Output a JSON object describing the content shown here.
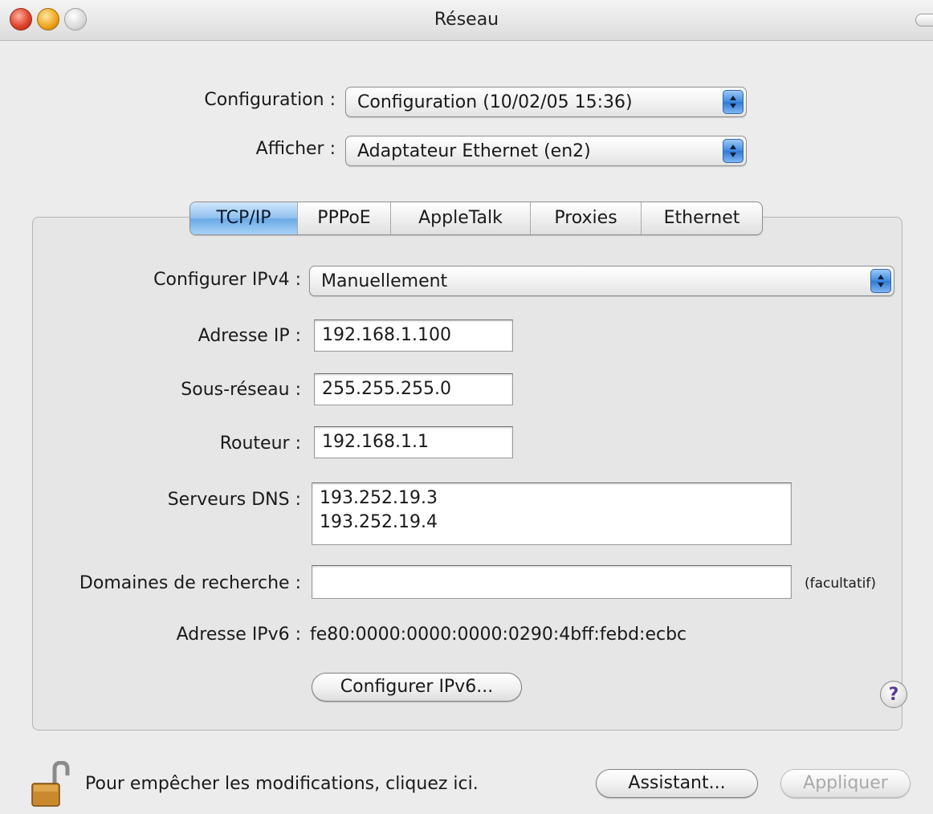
{
  "window": {
    "title": "Réseau"
  },
  "top": {
    "configuration_label": "Configuration :",
    "configuration_value": "Configuration (10/02/05 15:36)",
    "afficher_label": "Afficher :",
    "afficher_value": "Adaptateur Ethernet (en2)"
  },
  "tabs": [
    {
      "label": "TCP/IP",
      "selected": true
    },
    {
      "label": "PPPoE",
      "selected": false
    },
    {
      "label": "AppleTalk",
      "selected": false
    },
    {
      "label": "Proxies",
      "selected": false
    },
    {
      "label": "Ethernet",
      "selected": false
    }
  ],
  "tcpip": {
    "configure_ipv4_label": "Configurer IPv4 :",
    "configure_ipv4_value": "Manuellement",
    "ip_label": "Adresse IP :",
    "ip_value": "192.168.1.100",
    "subnet_label": "Sous-réseau :",
    "subnet_value": "255.255.255.0",
    "router_label": "Routeur :",
    "router_value": "192.168.1.1",
    "dns_label": "Serveurs DNS :",
    "dns_values": [
      "193.252.19.3",
      "193.252.19.4"
    ],
    "search_domains_label": "Domaines de recherche :",
    "search_domains_value": "",
    "optional_note": "(facultatif)",
    "ipv6_label": "Adresse IPv6 :",
    "ipv6_value": "fe80:0000:0000:0000:0290:4bff:febd:ecbc",
    "configure_ipv6_button": "Configurer IPv6...",
    "help_glyph": "?"
  },
  "footer": {
    "lock_text": "Pour empêcher les modifications, cliquez ici.",
    "assistant_button": "Assistant...",
    "apply_button": "Appliquer"
  },
  "colors": {
    "selected_tab": "#8fc0ee",
    "popup_arrows": "#3e8ae0",
    "window_bg": "#ececec"
  }
}
